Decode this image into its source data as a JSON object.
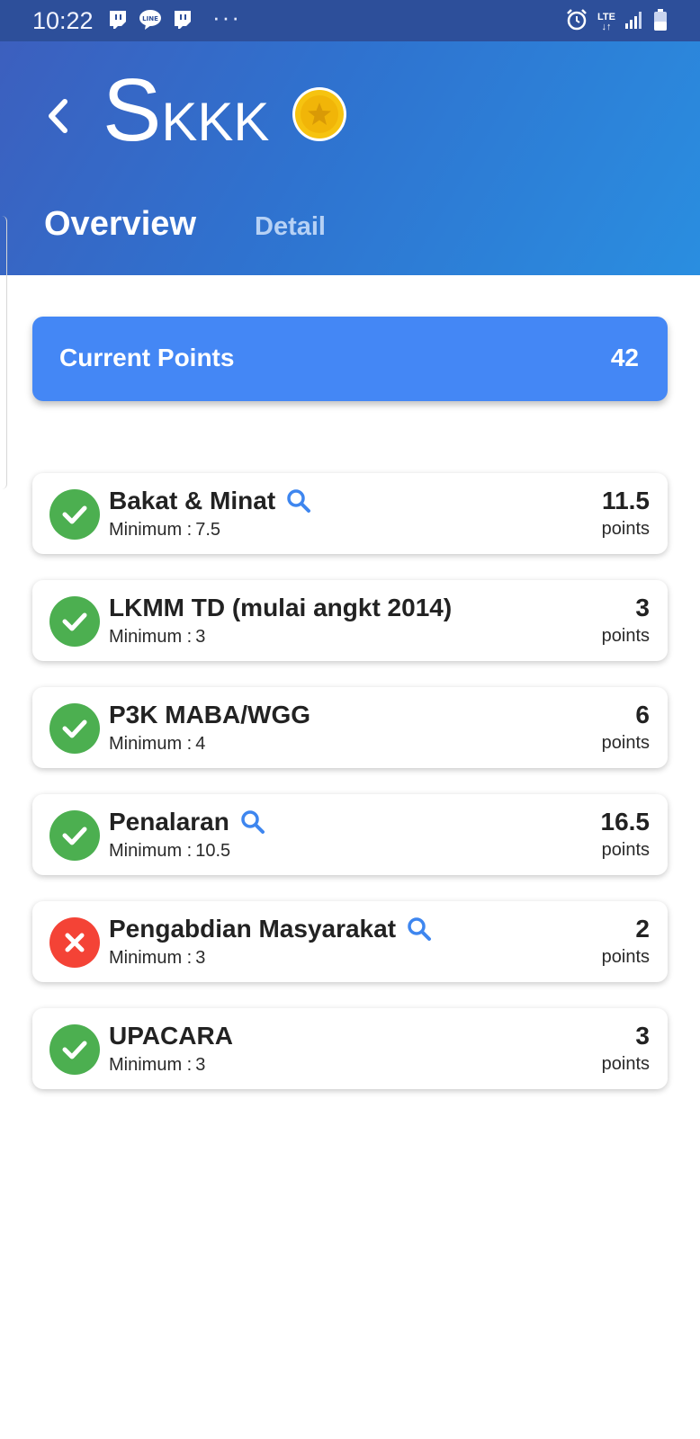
{
  "status_bar": {
    "time": "10:22",
    "app_icons": [
      "twitch-icon",
      "line-icon",
      "twitch-icon"
    ],
    "more": "···",
    "network": "LTE"
  },
  "header": {
    "title_initial": "S",
    "title_rest": "KKK",
    "tabs": [
      {
        "label": "Overview",
        "active": true
      },
      {
        "label": "Detail",
        "active": false
      }
    ]
  },
  "points": {
    "label": "Current Points",
    "value": "42"
  },
  "requirements": [
    {
      "name": "Bakat & Minat",
      "min_label": "Minimum :",
      "min_value": "7.5",
      "value": "11.5",
      "unit": "points",
      "status": "ok",
      "searchable": true
    },
    {
      "name": "LKMM TD (mulai angkt 2014)",
      "min_label": "Minimum :",
      "min_value": "3",
      "value": "3",
      "unit": "points",
      "status": "ok",
      "searchable": false
    },
    {
      "name": "P3K MABA/WGG",
      "min_label": "Minimum :",
      "min_value": "4",
      "value": "6",
      "unit": "points",
      "status": "ok",
      "searchable": false
    },
    {
      "name": "Penalaran",
      "min_label": "Minimum :",
      "min_value": "10.5",
      "value": "16.5",
      "unit": "points",
      "status": "ok",
      "searchable": true
    },
    {
      "name": "Pengabdian Masyarakat",
      "min_label": "Minimum :",
      "min_value": "3",
      "value": "2",
      "unit": "points",
      "status": "bad",
      "searchable": true
    },
    {
      "name": "UPACARA",
      "min_label": "Minimum :",
      "min_value": "3",
      "value": "3",
      "unit": "points",
      "status": "ok",
      "searchable": false
    }
  ],
  "colors": {
    "accent": "#4487f5",
    "ok": "#4caf50",
    "bad": "#f44336",
    "search": "#3e86ef"
  }
}
